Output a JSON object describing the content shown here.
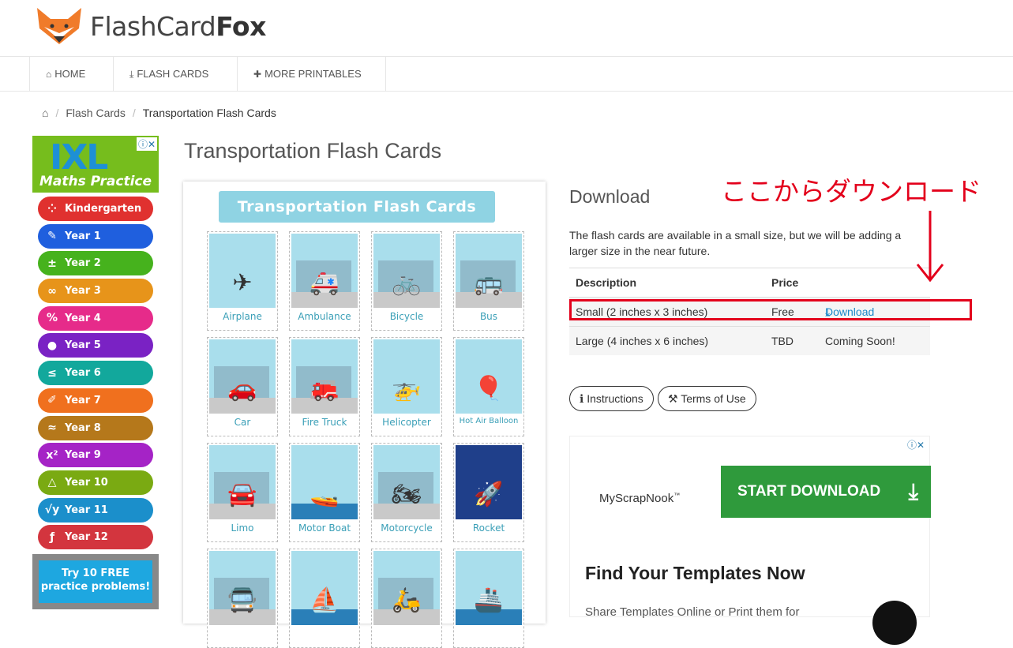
{
  "site": {
    "logo_light": "FlashCard",
    "logo_bold": "Fox"
  },
  "nav": [
    {
      "icon": "home-icon",
      "glyph": "⌂",
      "label": "HOME"
    },
    {
      "icon": "download-icon",
      "glyph": "⤓",
      "label": "FLASH CARDS"
    },
    {
      "icon": "plus-icon",
      "glyph": "✚",
      "label": "MORE PRINTABLES"
    }
  ],
  "breadcrumb": {
    "home_glyph": "⌂",
    "items": [
      "Flash Cards",
      "Transportation Flash Cards"
    ]
  },
  "left_ad": {
    "brand": "IXL",
    "subtitle": "Maths Practice",
    "info": "ⓘ✕",
    "years": [
      {
        "label": "Kindergarten",
        "glyph": "⁘",
        "color": "#e0312f"
      },
      {
        "label": "Year 1",
        "glyph": "✎",
        "color": "#1f5fde"
      },
      {
        "label": "Year 2",
        "glyph": "±",
        "color": "#46b21d"
      },
      {
        "label": "Year 3",
        "glyph": "∞",
        "color": "#e7941a"
      },
      {
        "label": "Year 4",
        "glyph": "%",
        "color": "#e62b8a"
      },
      {
        "label": "Year 5",
        "glyph": "●",
        "color": "#7a22c4"
      },
      {
        "label": "Year 6",
        "glyph": "≤",
        "color": "#12a89c"
      },
      {
        "label": "Year 7",
        "glyph": "✐",
        "color": "#f0701e"
      },
      {
        "label": "Year 8",
        "glyph": "≈",
        "color": "#b5781b"
      },
      {
        "label": "Year 9",
        "glyph": "x²",
        "color": "#a523c6"
      },
      {
        "label": "Year 10",
        "glyph": "△",
        "color": "#7aaa12"
      },
      {
        "label": "Year 11",
        "glyph": "√y",
        "color": "#1b8fcb"
      },
      {
        "label": "Year 12",
        "glyph": "ƒ",
        "color": "#d3353e"
      }
    ],
    "cta_line1": "Try 10 FREE",
    "cta_line2": "practice problems!"
  },
  "main": {
    "title": "Transportation Flash Cards",
    "banner": "Transportation Flash Cards",
    "cards": [
      {
        "label": "Airplane",
        "glyph": "✈",
        "ground": false
      },
      {
        "label": "Ambulance",
        "glyph": "🚑",
        "ground": true
      },
      {
        "label": "Bicycle",
        "glyph": "🚲",
        "ground": true
      },
      {
        "label": "Bus",
        "glyph": "🚌",
        "ground": true
      },
      {
        "label": "Car",
        "glyph": "🚗",
        "ground": true
      },
      {
        "label": "Fire Truck",
        "glyph": "🚒",
        "ground": true
      },
      {
        "label": "Helicopter",
        "glyph": "🚁",
        "ground": false
      },
      {
        "label": "Hot Air Balloon",
        "glyph": "🎈",
        "ground": false
      },
      {
        "label": "Limo",
        "glyph": "🚘",
        "ground": true
      },
      {
        "label": "Motor Boat",
        "glyph": "🚤",
        "ground": false
      },
      {
        "label": "Motorcycle",
        "glyph": "🏍",
        "ground": true
      },
      {
        "label": "Rocket",
        "glyph": "🚀",
        "ground": false
      },
      {
        "label": "",
        "glyph": "🚍",
        "ground": true
      },
      {
        "label": "",
        "glyph": "⛵",
        "ground": false
      },
      {
        "label": "",
        "glyph": "🛵",
        "ground": true
      },
      {
        "label": "",
        "glyph": "🚢",
        "ground": false
      }
    ]
  },
  "download": {
    "title": "Download",
    "text": "The flash cards are available in a small size, but we will be adding a larger size in the near future.",
    "headers": {
      "desc": "Description",
      "price": "Price"
    },
    "rows": [
      {
        "desc": "Small (2 inches x 3 inches)",
        "price": "Free",
        "action": "Download"
      },
      {
        "desc": "Large (4 inches x 6 inches)",
        "price": "TBD",
        "action": "Coming Soon!"
      }
    ],
    "annotation": "ここからダウンロード",
    "instructions": "Instructions",
    "terms": "Terms of Use"
  },
  "right_ad": {
    "brand": "MyScrapNook",
    "tm": "™",
    "button": "START DOWNLOAD",
    "headline": "Find Your Templates Now",
    "body": "Share Templates Online or Print them for",
    "info": "ⓘ✕"
  }
}
